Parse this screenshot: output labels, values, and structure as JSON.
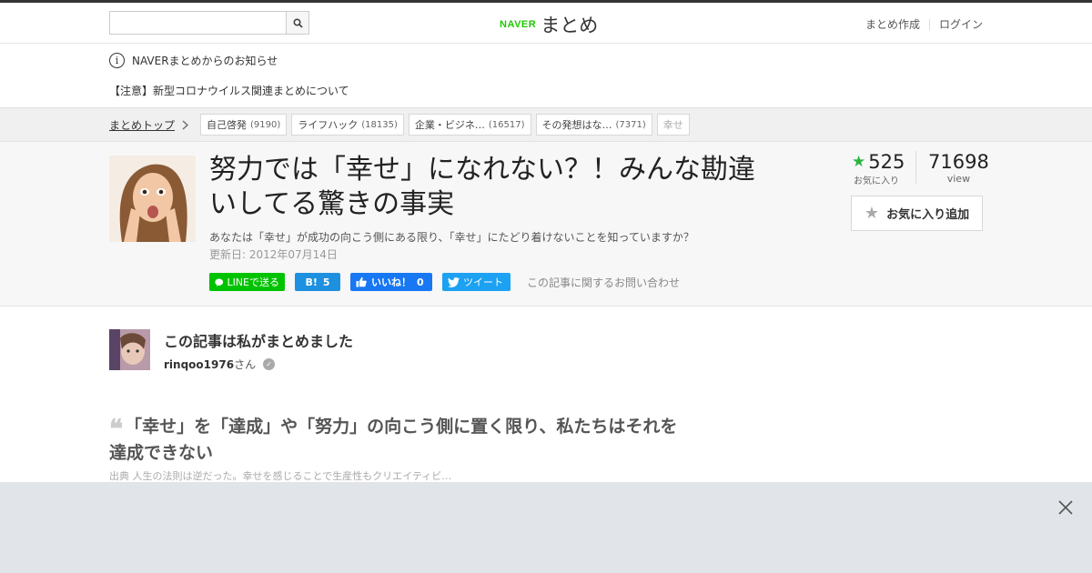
{
  "header": {
    "search": {
      "placeholder": "",
      "value": ""
    },
    "logo_brand": "NAVER",
    "logo_name": "まとめ",
    "links": [
      "まとめ作成",
      "ログイン"
    ]
  },
  "notice": {
    "title": "NAVERまとめからのお知らせ",
    "message": "【注意】新型コロナウイルス関連まとめについて"
  },
  "breadcrumb": {
    "top": "まとめトップ",
    "tags": [
      {
        "label": "自己啓発",
        "count": "(9190)"
      },
      {
        "label": "ライフハック",
        "count": "(18135)"
      },
      {
        "label": "企業・ビジネ…",
        "count": "(16517)"
      },
      {
        "label": "その発想はな…",
        "count": "(7371)"
      },
      {
        "label": "幸せ",
        "count": ""
      }
    ]
  },
  "article": {
    "title": "努力では「幸せ」になれない？！みんな勘違いしてる驚きの事実",
    "description": "あなたは「幸せ」が成功の向こう側にある限り、「幸せ」にたどり着けないことを知っていますか？",
    "updated": "更新日: 2012年07月14日",
    "favorites": "525",
    "favorites_label": "お気に入り",
    "views": "71698",
    "views_label": "view",
    "fav_button": "お気に入り追加",
    "share": {
      "line": "LINEで送る",
      "hatena_count": "5",
      "facebook": "いいね！",
      "facebook_count": "0",
      "twitter": "ツイート"
    },
    "contact": "この記事に関するお問い合わせ"
  },
  "author": {
    "heading": "この記事は私がまとめました",
    "name": "rinqoo1976",
    "suffix": "さん"
  },
  "quote": {
    "text": "「幸せ」を「達成」や「努力」の向こう側に置く限り、私たちはそれを達成できない",
    "source": "出典 人生の法則は逆だった。幸せを感じることで生産性もクリエイティビ…"
  },
  "colors": {
    "accent_green": "#1ec800",
    "line_green": "#00c300",
    "facebook": "#1877f2",
    "twitter": "#1da1f2",
    "hatena": "#1e90e0"
  }
}
